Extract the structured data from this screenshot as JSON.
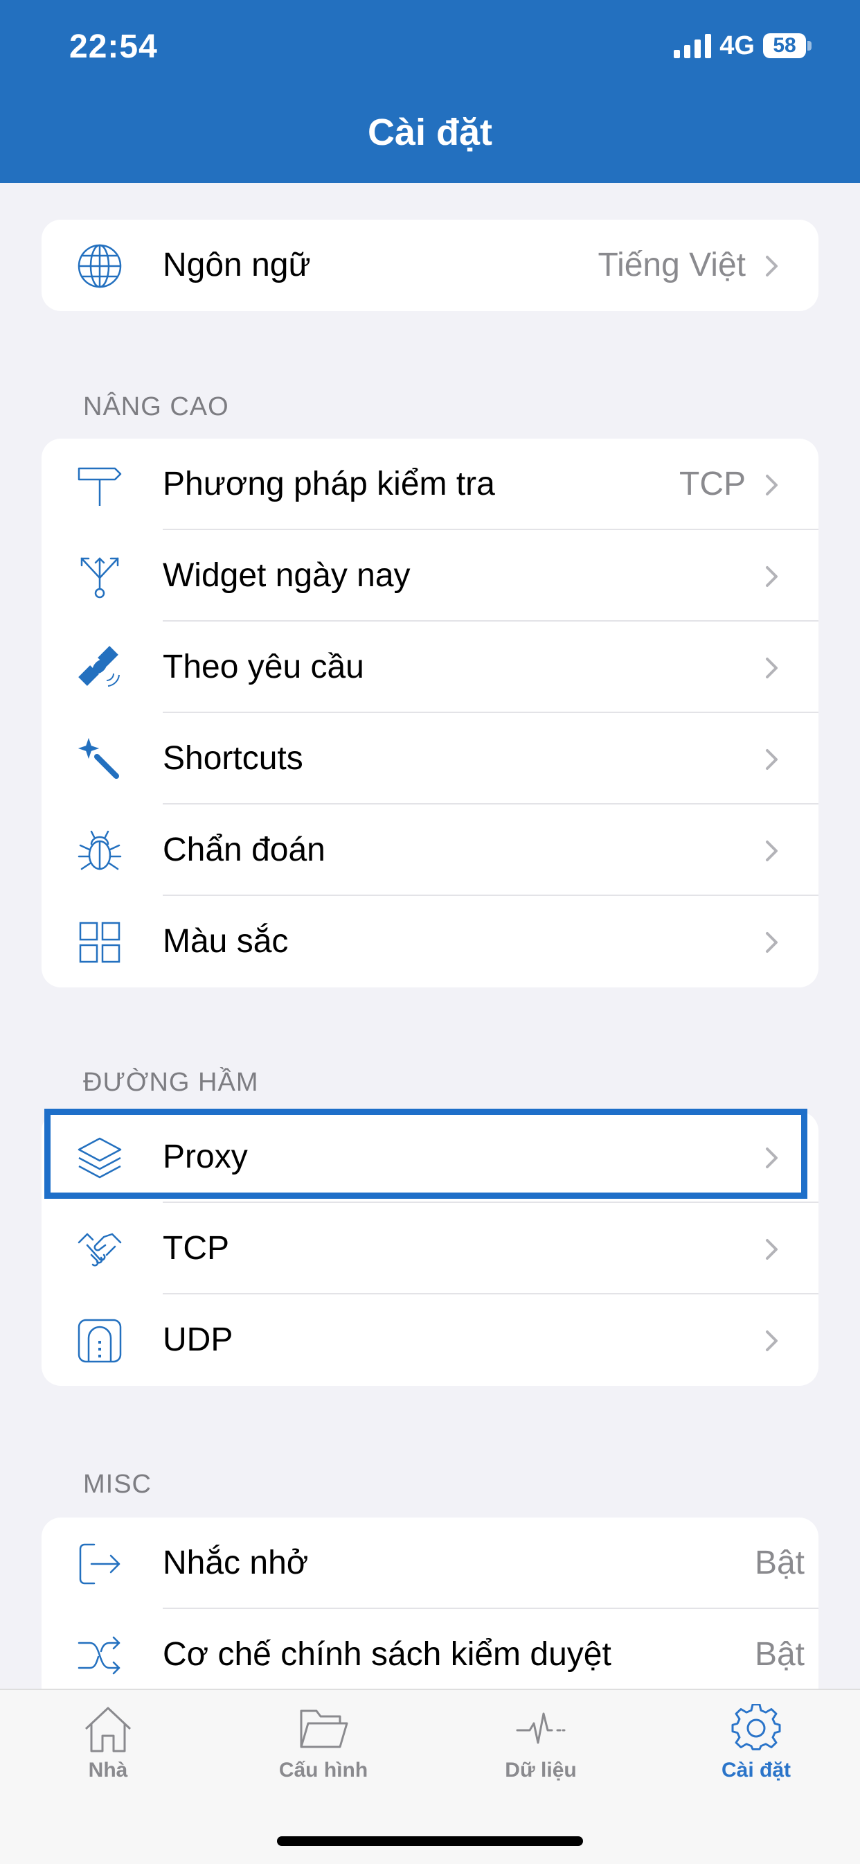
{
  "status_bar": {
    "time": "22:54",
    "network": "4G",
    "battery": "58"
  },
  "header": {
    "title": "Cài đặt"
  },
  "language": {
    "label": "Ngôn ngữ",
    "value": "Tiếng Việt"
  },
  "advanced": {
    "header": "NÂNG CAO",
    "items": [
      {
        "label": "Phương pháp kiểm tra",
        "value": "TCP",
        "icon": "signpost-icon"
      },
      {
        "label": "Widget ngày nay",
        "value": "",
        "icon": "fork-arrows-icon"
      },
      {
        "label": "Theo yêu cầu",
        "value": "",
        "icon": "satellite-icon"
      },
      {
        "label": "Shortcuts",
        "value": "",
        "icon": "magic-wand-icon"
      },
      {
        "label": "Chẩn đoán",
        "value": "",
        "icon": "bug-icon"
      },
      {
        "label": "Màu sắc",
        "value": "",
        "icon": "grid-icon"
      }
    ]
  },
  "tunnel": {
    "header": "ĐƯỜNG HẦM",
    "items": [
      {
        "label": "Proxy",
        "icon": "layers-icon"
      },
      {
        "label": "TCP",
        "icon": "handshake-icon"
      },
      {
        "label": "UDP",
        "icon": "tunnel-icon"
      }
    ]
  },
  "misc": {
    "header": "MISC",
    "items": [
      {
        "label": "Nhắc nhở",
        "value": "Bật",
        "icon": "exit-arrow-icon"
      },
      {
        "label": "Cơ chế chính sách kiểm duyệt",
        "value": "Bật",
        "icon": "shuffle-icon"
      }
    ]
  },
  "tabbar": {
    "tabs": [
      {
        "label": "Nhà",
        "icon": "home-icon",
        "active": false
      },
      {
        "label": "Cấu hình",
        "icon": "folder-icon",
        "active": false
      },
      {
        "label": "Dữ liệu",
        "icon": "pulse-icon",
        "active": false
      },
      {
        "label": "Cài đặt",
        "icon": "gear-icon",
        "active": true
      }
    ]
  },
  "colors": {
    "brand": "#2370bf",
    "accent": "#2a74c9",
    "highlight": "#1e6fc9",
    "background": "#f2f2f7"
  }
}
